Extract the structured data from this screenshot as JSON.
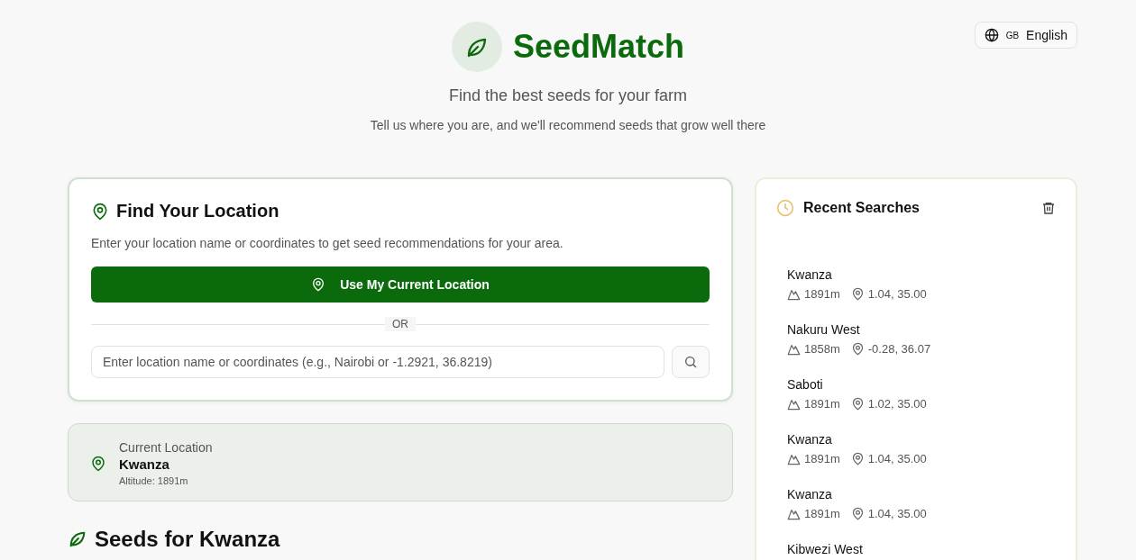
{
  "header": {
    "brand": "SeedMatch",
    "tagline": "Find the best seeds for your farm",
    "subtitle": "Tell us where you are, and we'll recommend seeds that grow well there"
  },
  "language": {
    "code": "GB",
    "label": "English"
  },
  "find_location": {
    "title": "Find Your Location",
    "description": "Enter your location name or coordinates to get seed recommendations for your area.",
    "button": "Use My Current Location",
    "divider": "OR",
    "search": {
      "placeholder": "Enter location name or coordinates (e.g., Nairobi or -1.2921, 36.8219)"
    }
  },
  "current_location": {
    "label": "Current Location",
    "name": "Kwanza",
    "altitude": "Altitude: 1891m"
  },
  "seeds_heading": "Seeds for Kwanza",
  "recent_searches": {
    "title": "Recent Searches",
    "items": [
      {
        "name": "Kwanza",
        "altitude": "1891m",
        "coords": "1.04, 35.00"
      },
      {
        "name": "Nakuru West",
        "altitude": "1858m",
        "coords": "-0.28, 36.07"
      },
      {
        "name": "Saboti",
        "altitude": "1891m",
        "coords": "1.02, 35.00"
      },
      {
        "name": "Kwanza",
        "altitude": "1891m",
        "coords": "1.04, 35.00"
      },
      {
        "name": "Kwanza",
        "altitude": "1891m",
        "coords": "1.04, 35.00"
      },
      {
        "name": "Kibwezi West"
      }
    ]
  }
}
